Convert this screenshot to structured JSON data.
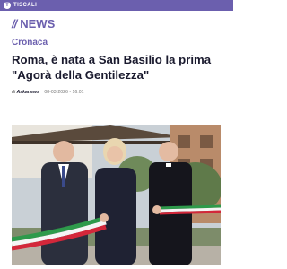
{
  "topbar": {
    "logo_letter": "T",
    "brand": "TISCALI",
    "brand_color": "#6b5fae"
  },
  "section": {
    "slashes": "//",
    "title": "NEWS"
  },
  "article": {
    "category": "Cronaca",
    "headline": "Roma, è nata a San Basilio la prima \"Agorà della Gentilezza\"",
    "byline_prefix": "di",
    "author": "Askanews",
    "date": "08-03-2026 - 16:01"
  },
  "photo": {
    "subject": "ribbon-cutting-ceremony"
  }
}
